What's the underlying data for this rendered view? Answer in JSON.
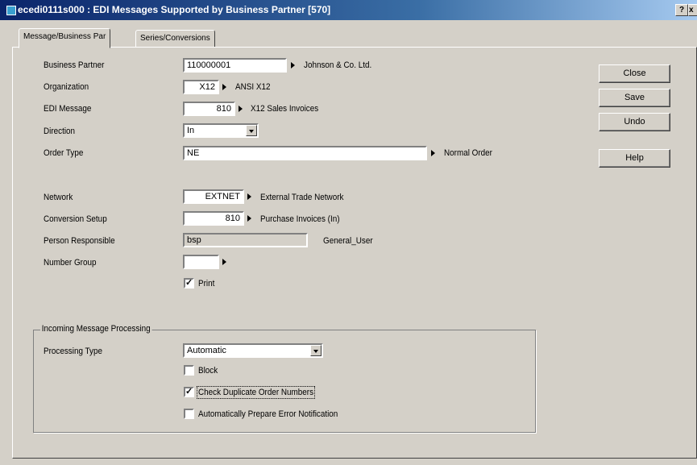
{
  "window": {
    "title": "ecedi0111s000 : EDI Messages Supported by Business Partner [570]",
    "help_glyph": "?",
    "close_glyph": "x"
  },
  "tabs": [
    {
      "label": "Message/Business Par"
    },
    {
      "label": "Series/Conversions"
    }
  ],
  "form": {
    "business_partner": {
      "label": "Business Partner",
      "value": "110000001",
      "description": "Johnson & Co. Ltd."
    },
    "organization": {
      "label": "Organization",
      "value": "X12",
      "description": "ANSI X12"
    },
    "edi_message": {
      "label": "EDI Message",
      "value": "810",
      "description": "X12 Sales Invoices"
    },
    "direction": {
      "label": "Direction",
      "value": "In"
    },
    "order_type": {
      "label": "Order Type",
      "value": "NE",
      "description": "Normal Order"
    },
    "network": {
      "label": "Network",
      "value": "EXTNET",
      "description": "External Trade Network"
    },
    "conversion_setup": {
      "label": "Conversion Setup",
      "value": "810",
      "description": "Purchase Invoices (In)"
    },
    "person_responsible": {
      "label": "Person Responsible",
      "value": "bsp",
      "description": "General_User"
    },
    "number_group": {
      "label": "Number Group",
      "value": ""
    },
    "print": {
      "label": "Print",
      "checked": true
    }
  },
  "incoming": {
    "group_label": "Incoming Message Processing",
    "processing_type": {
      "label": "Processing Type",
      "value": "Automatic"
    },
    "block": {
      "label": "Block",
      "checked": false
    },
    "check_duplicate": {
      "label": "Check Duplicate Order Numbers",
      "checked": true
    },
    "auto_error": {
      "label": "Automatically Prepare Error Notification",
      "checked": false
    }
  },
  "buttons": {
    "close": "Close",
    "save": "Save",
    "undo": "Undo",
    "help": "Help"
  },
  "check_glyph": "✓"
}
